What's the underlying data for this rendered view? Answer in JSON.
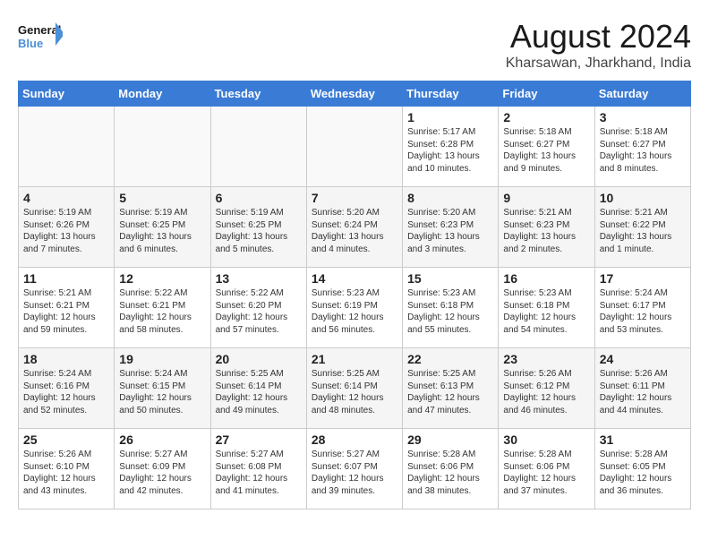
{
  "header": {
    "logo_line1": "General",
    "logo_line2": "Blue",
    "month_year": "August 2024",
    "location": "Kharsawan, Jharkhand, India"
  },
  "weekdays": [
    "Sunday",
    "Monday",
    "Tuesday",
    "Wednesday",
    "Thursday",
    "Friday",
    "Saturday"
  ],
  "weeks": [
    [
      {
        "day": "",
        "content": ""
      },
      {
        "day": "",
        "content": ""
      },
      {
        "day": "",
        "content": ""
      },
      {
        "day": "",
        "content": ""
      },
      {
        "day": "1",
        "content": "Sunrise: 5:17 AM\nSunset: 6:28 PM\nDaylight: 13 hours\nand 10 minutes."
      },
      {
        "day": "2",
        "content": "Sunrise: 5:18 AM\nSunset: 6:27 PM\nDaylight: 13 hours\nand 9 minutes."
      },
      {
        "day": "3",
        "content": "Sunrise: 5:18 AM\nSunset: 6:27 PM\nDaylight: 13 hours\nand 8 minutes."
      }
    ],
    [
      {
        "day": "4",
        "content": "Sunrise: 5:19 AM\nSunset: 6:26 PM\nDaylight: 13 hours\nand 7 minutes."
      },
      {
        "day": "5",
        "content": "Sunrise: 5:19 AM\nSunset: 6:25 PM\nDaylight: 13 hours\nand 6 minutes."
      },
      {
        "day": "6",
        "content": "Sunrise: 5:19 AM\nSunset: 6:25 PM\nDaylight: 13 hours\nand 5 minutes."
      },
      {
        "day": "7",
        "content": "Sunrise: 5:20 AM\nSunset: 6:24 PM\nDaylight: 13 hours\nand 4 minutes."
      },
      {
        "day": "8",
        "content": "Sunrise: 5:20 AM\nSunset: 6:23 PM\nDaylight: 13 hours\nand 3 minutes."
      },
      {
        "day": "9",
        "content": "Sunrise: 5:21 AM\nSunset: 6:23 PM\nDaylight: 13 hours\nand 2 minutes."
      },
      {
        "day": "10",
        "content": "Sunrise: 5:21 AM\nSunset: 6:22 PM\nDaylight: 13 hours\nand 1 minute."
      }
    ],
    [
      {
        "day": "11",
        "content": "Sunrise: 5:21 AM\nSunset: 6:21 PM\nDaylight: 12 hours\nand 59 minutes."
      },
      {
        "day": "12",
        "content": "Sunrise: 5:22 AM\nSunset: 6:21 PM\nDaylight: 12 hours\nand 58 minutes."
      },
      {
        "day": "13",
        "content": "Sunrise: 5:22 AM\nSunset: 6:20 PM\nDaylight: 12 hours\nand 57 minutes."
      },
      {
        "day": "14",
        "content": "Sunrise: 5:23 AM\nSunset: 6:19 PM\nDaylight: 12 hours\nand 56 minutes."
      },
      {
        "day": "15",
        "content": "Sunrise: 5:23 AM\nSunset: 6:18 PM\nDaylight: 12 hours\nand 55 minutes."
      },
      {
        "day": "16",
        "content": "Sunrise: 5:23 AM\nSunset: 6:18 PM\nDaylight: 12 hours\nand 54 minutes."
      },
      {
        "day": "17",
        "content": "Sunrise: 5:24 AM\nSunset: 6:17 PM\nDaylight: 12 hours\nand 53 minutes."
      }
    ],
    [
      {
        "day": "18",
        "content": "Sunrise: 5:24 AM\nSunset: 6:16 PM\nDaylight: 12 hours\nand 52 minutes."
      },
      {
        "day": "19",
        "content": "Sunrise: 5:24 AM\nSunset: 6:15 PM\nDaylight: 12 hours\nand 50 minutes."
      },
      {
        "day": "20",
        "content": "Sunrise: 5:25 AM\nSunset: 6:14 PM\nDaylight: 12 hours\nand 49 minutes."
      },
      {
        "day": "21",
        "content": "Sunrise: 5:25 AM\nSunset: 6:14 PM\nDaylight: 12 hours\nand 48 minutes."
      },
      {
        "day": "22",
        "content": "Sunrise: 5:25 AM\nSunset: 6:13 PM\nDaylight: 12 hours\nand 47 minutes."
      },
      {
        "day": "23",
        "content": "Sunrise: 5:26 AM\nSunset: 6:12 PM\nDaylight: 12 hours\nand 46 minutes."
      },
      {
        "day": "24",
        "content": "Sunrise: 5:26 AM\nSunset: 6:11 PM\nDaylight: 12 hours\nand 44 minutes."
      }
    ],
    [
      {
        "day": "25",
        "content": "Sunrise: 5:26 AM\nSunset: 6:10 PM\nDaylight: 12 hours\nand 43 minutes."
      },
      {
        "day": "26",
        "content": "Sunrise: 5:27 AM\nSunset: 6:09 PM\nDaylight: 12 hours\nand 42 minutes."
      },
      {
        "day": "27",
        "content": "Sunrise: 5:27 AM\nSunset: 6:08 PM\nDaylight: 12 hours\nand 41 minutes."
      },
      {
        "day": "28",
        "content": "Sunrise: 5:27 AM\nSunset: 6:07 PM\nDaylight: 12 hours\nand 39 minutes."
      },
      {
        "day": "29",
        "content": "Sunrise: 5:28 AM\nSunset: 6:06 PM\nDaylight: 12 hours\nand 38 minutes."
      },
      {
        "day": "30",
        "content": "Sunrise: 5:28 AM\nSunset: 6:06 PM\nDaylight: 12 hours\nand 37 minutes."
      },
      {
        "day": "31",
        "content": "Sunrise: 5:28 AM\nSunset: 6:05 PM\nDaylight: 12 hours\nand 36 minutes."
      }
    ]
  ]
}
